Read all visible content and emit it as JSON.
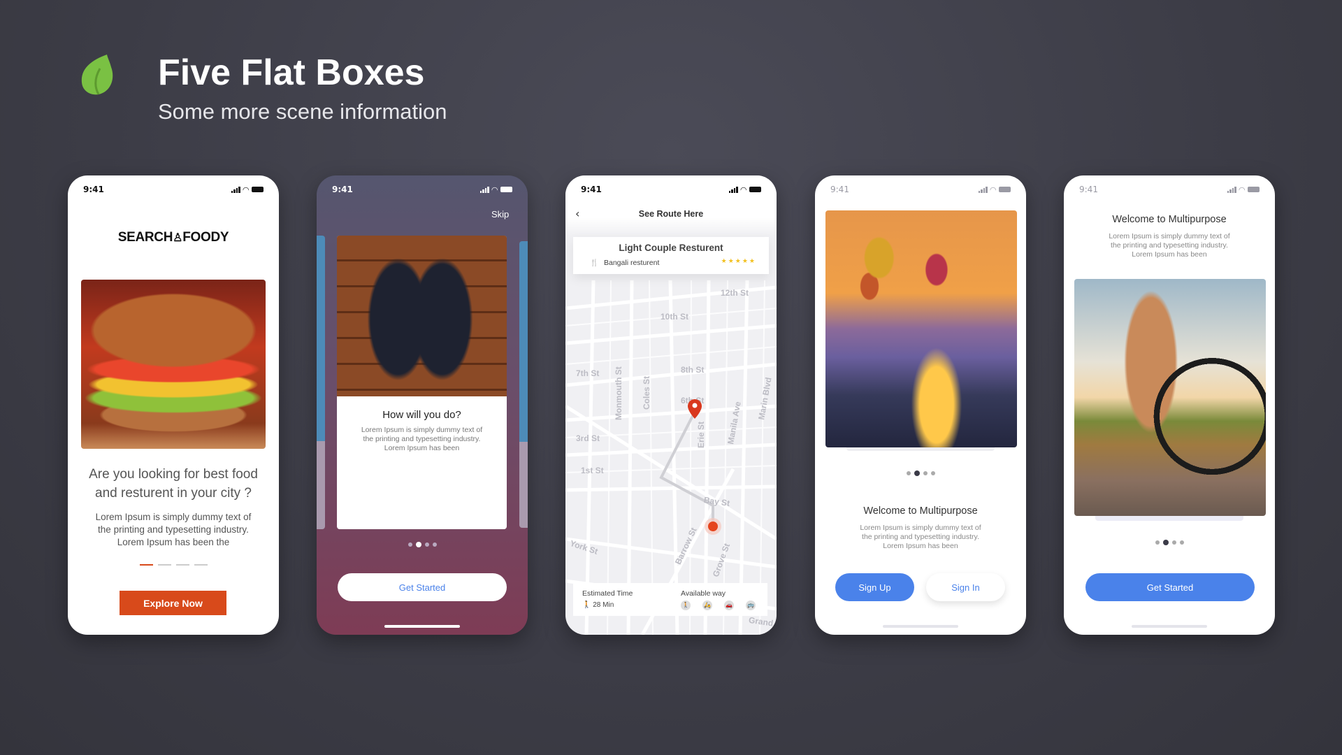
{
  "header": {
    "title": "Five Flat Boxes",
    "subtitle": "Some more scene information",
    "logo_icon": "leaf-icon",
    "logo_color": "#7ac143"
  },
  "status_time": "9:41",
  "phones": [
    {
      "logo": "SEARCH FOODY",
      "logo_part1": "SEARCH",
      "logo_part2": "FOODY",
      "headline1": "Are you looking for best food",
      "headline2": "and resturent in your city ?",
      "body1": "Lorem Ipsum is simply dummy text of",
      "body2": "the printing and typesetting industry.",
      "body3": "Lorem Ipsum has been the",
      "button": "Explore Now",
      "accent": "#d84a1b",
      "active_slide": 1,
      "slide_count": 4
    },
    {
      "skip": "Skip",
      "title": "How will you do?",
      "body1": "Lorem Ipsum is simply dummy text of",
      "body2": "the printing and typesetting industry.",
      "body3": "Lorem Ipsum has been",
      "button": "Get Started",
      "active_slide": 2,
      "slide_count": 4
    },
    {
      "header": "See Route Here",
      "restaurant": "Light Couple Resturent",
      "category": "Bangali resturent",
      "rating": 5,
      "stars": "★★★★★",
      "streets": [
        "12th St",
        "10th St",
        "7th St",
        "8th St",
        "6th St",
        "3rd St",
        "1st St",
        "Bay St",
        "York St",
        "Monmouth St",
        "Coles St",
        "Erie St",
        "Manila Ave",
        "Marin Blvd",
        "Barrow St",
        "Grove St",
        "Grand"
      ],
      "estimated_label": "Estimated Time",
      "estimated_value": "28 Min",
      "available_label": "Available way",
      "ways": [
        "walk-icon",
        "scooter-icon",
        "car-icon",
        "bus-icon"
      ],
      "pin_color": "#d9381e"
    },
    {
      "title": "Welcome to Multipurpose",
      "body1": "Lorem Ipsum is simply dummy text of",
      "body2": "the printing and typesetting industry.",
      "body3": "Lorem Ipsum has been",
      "signup": "Sign Up",
      "signin": "Sign In",
      "accent": "#4a82ea",
      "active_slide": 2,
      "slide_count": 4
    },
    {
      "title": "Welcome to Multipurpose",
      "body1": "Lorem Ipsum is simply dummy text of",
      "body2": "the printing and typesetting industry.",
      "body3": "Lorem Ipsum has been",
      "button": "Get Started",
      "accent": "#4a82ea",
      "active_slide": 2,
      "slide_count": 4
    }
  ]
}
